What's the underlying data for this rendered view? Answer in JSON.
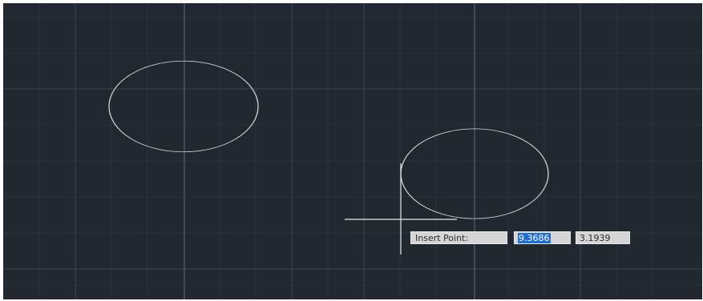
{
  "drawing": {
    "background": "#212830",
    "grid_minor_color": "#2b323b",
    "grid_major_color": "#3a4350",
    "axis_color": "#55627a",
    "geometry_color": "#d8d8d8",
    "entities": [
      {
        "type": "circle",
        "name": "circle-left"
      },
      {
        "type": "circle",
        "name": "circle-right"
      }
    ]
  },
  "cursor": {
    "type": "crosshair"
  },
  "dynamic_input": {
    "prompt": "Insert Point:",
    "x_value": "9.3686",
    "y_value": "3.1939",
    "highlight_color": "#1f6fd6"
  }
}
